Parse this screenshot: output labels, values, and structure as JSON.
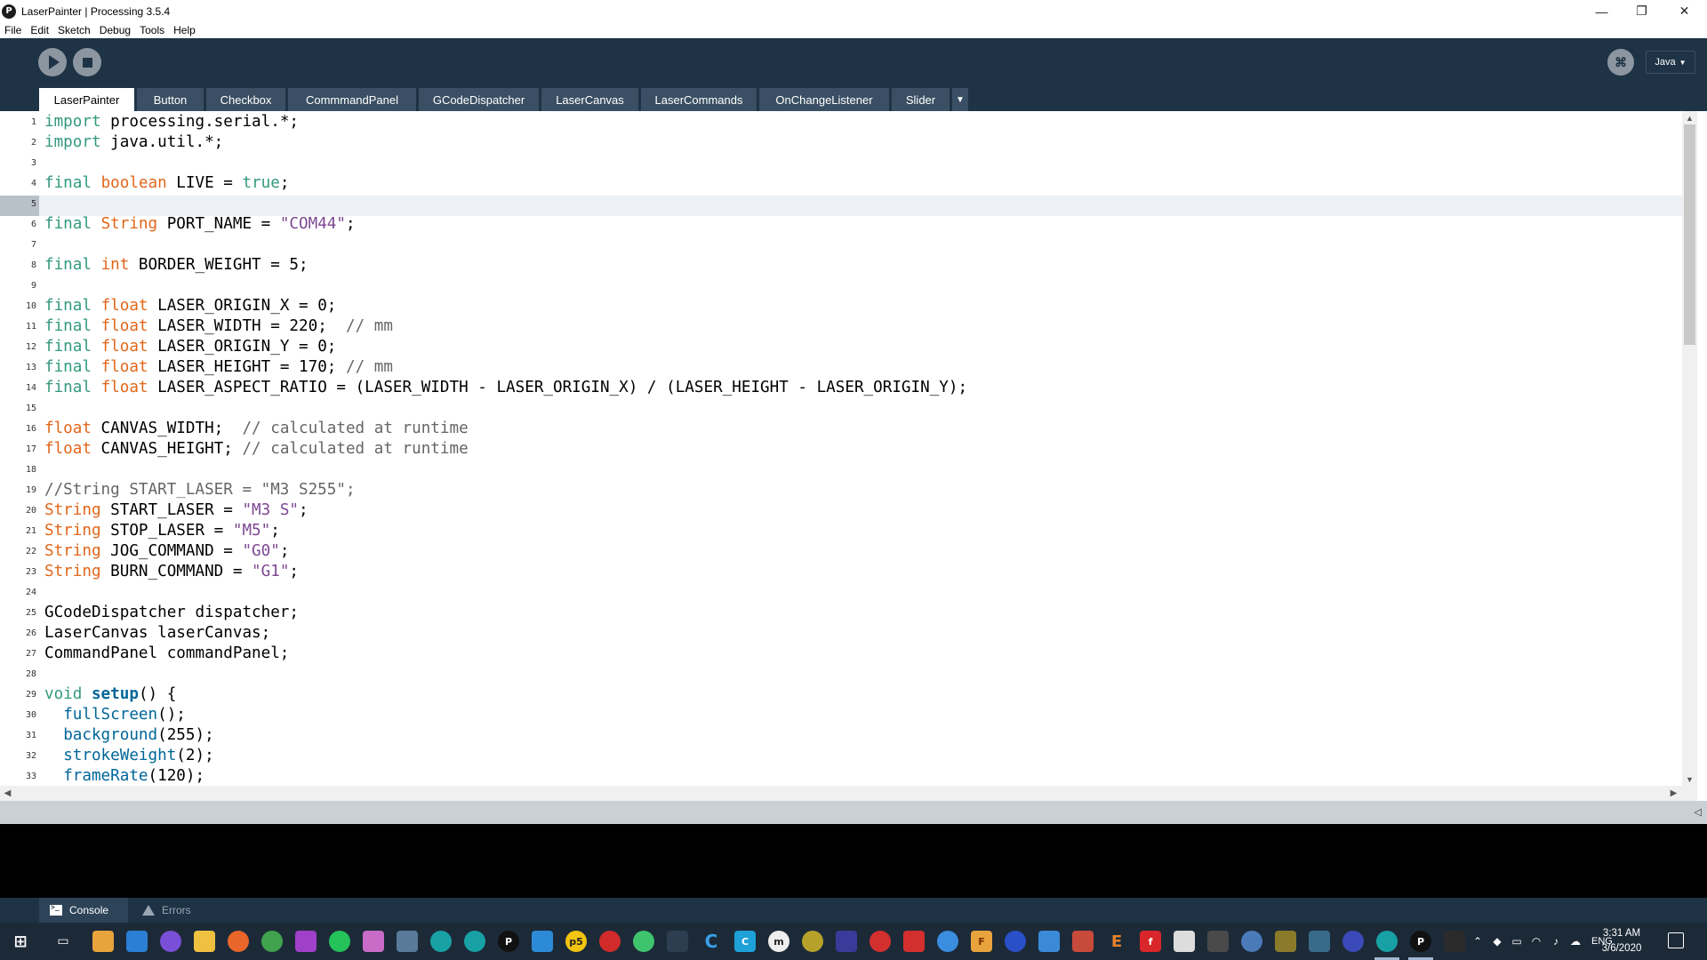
{
  "window": {
    "title": "LaserPainter | Processing 3.5.4",
    "app_icon_letter": "P",
    "controls": {
      "minimize": "—",
      "restore": "❐",
      "close": "✕"
    }
  },
  "menu": [
    "File",
    "Edit",
    "Sketch",
    "Debug",
    "Tools",
    "Help"
  ],
  "toolbar": {
    "run_label": "Run",
    "stop_label": "Stop",
    "mode_label": "Java",
    "mode_arrow": "▼"
  },
  "tabs": [
    {
      "label": "LaserPainter",
      "active": true
    },
    {
      "label": "Button"
    },
    {
      "label": "Checkbox"
    },
    {
      "label": "CommmandPanel"
    },
    {
      "label": "GCodeDispatcher"
    },
    {
      "label": "LaserCanvas"
    },
    {
      "label": "LaserCommands"
    },
    {
      "label": "OnChangeListener"
    },
    {
      "label": "Slider"
    }
  ],
  "tab_more_arrow": "▼",
  "editor": {
    "highlighted_line": 5,
    "lines": [
      {
        "n": "1",
        "tokens": [
          [
            "kw1",
            "import"
          ],
          [
            "",
            "processing.serial.*;"
          ]
        ]
      },
      {
        "n": "2",
        "tokens": [
          [
            "kw1",
            "import"
          ],
          [
            "",
            "java.util.*;"
          ]
        ]
      },
      {
        "n": "3",
        "tokens": []
      },
      {
        "n": "4",
        "tokens": [
          [
            "kw1",
            "final"
          ],
          [
            "",
            ""
          ],
          [
            "kw2",
            "boolean"
          ],
          [
            "",
            " LIVE = "
          ],
          [
            "kw1",
            "true"
          ],
          [
            "",
            ";"
          ]
        ]
      },
      {
        "n": "5",
        "tokens": []
      },
      {
        "n": "6",
        "tokens": [
          [
            "kw1",
            "final"
          ],
          [
            "",
            ""
          ],
          [
            "kw2",
            "String"
          ],
          [
            "",
            " PORT_NAME = "
          ],
          [
            "str",
            "\"COM44\""
          ],
          [
            "",
            ";"
          ]
        ]
      },
      {
        "n": "7",
        "tokens": []
      },
      {
        "n": "8",
        "tokens": [
          [
            "kw1",
            "final"
          ],
          [
            "",
            ""
          ],
          [
            "kw2",
            "int"
          ],
          [
            "",
            " BORDER_WEIGHT = 5;"
          ]
        ]
      },
      {
        "n": "9",
        "tokens": []
      },
      {
        "n": "10",
        "tokens": [
          [
            "kw1",
            "final"
          ],
          [
            "",
            ""
          ],
          [
            "kw2",
            "float"
          ],
          [
            "",
            " LASER_ORIGIN_X = 0;"
          ]
        ]
      },
      {
        "n": "11",
        "tokens": [
          [
            "kw1",
            "final"
          ],
          [
            "",
            ""
          ],
          [
            "kw2",
            "float"
          ],
          [
            "",
            " LASER_WIDTH = 220;  "
          ],
          [
            "cmt",
            "// mm"
          ]
        ]
      },
      {
        "n": "12",
        "tokens": [
          [
            "kw1",
            "final"
          ],
          [
            "",
            ""
          ],
          [
            "kw2",
            "float"
          ],
          [
            "",
            " LASER_ORIGIN_Y = 0;"
          ]
        ]
      },
      {
        "n": "13",
        "tokens": [
          [
            "kw1",
            "final"
          ],
          [
            "",
            ""
          ],
          [
            "kw2",
            "float"
          ],
          [
            "",
            " LASER_HEIGHT = 170; "
          ],
          [
            "cmt",
            "// mm"
          ]
        ]
      },
      {
        "n": "14",
        "tokens": [
          [
            "kw1",
            "final"
          ],
          [
            "",
            ""
          ],
          [
            "kw2",
            "float"
          ],
          [
            "",
            " LASER_ASPECT_RATIO = (LASER_WIDTH - LASER_ORIGIN_X) / (LASER_HEIGHT - LASER_ORIGIN_Y);"
          ]
        ]
      },
      {
        "n": "15",
        "tokens": []
      },
      {
        "n": "16",
        "tokens": [
          [
            "kw2",
            "float"
          ],
          [
            "",
            " CANVAS_WIDTH;  "
          ],
          [
            "cmt",
            "// calculated at runtime"
          ]
        ]
      },
      {
        "n": "17",
        "tokens": [
          [
            "kw2",
            "float"
          ],
          [
            "",
            " CANVAS_HEIGHT; "
          ],
          [
            "cmt",
            "// calculated at runtime"
          ]
        ]
      },
      {
        "n": "18",
        "tokens": []
      },
      {
        "n": "19",
        "tokens": [
          [
            "cmt",
            "//String START_LASER = \"M3 S255\";"
          ]
        ]
      },
      {
        "n": "20",
        "tokens": [
          [
            "kw2",
            "String"
          ],
          [
            "",
            " START_LASER = "
          ],
          [
            "str",
            "\"M3 S\""
          ],
          [
            "",
            ";"
          ]
        ]
      },
      {
        "n": "21",
        "tokens": [
          [
            "kw2",
            "String"
          ],
          [
            "",
            " STOP_LASER = "
          ],
          [
            "str",
            "\"M5\""
          ],
          [
            "",
            ";"
          ]
        ]
      },
      {
        "n": "22",
        "tokens": [
          [
            "kw2",
            "String"
          ],
          [
            "",
            " JOG_COMMAND = "
          ],
          [
            "str",
            "\"G0\""
          ],
          [
            "",
            ";"
          ]
        ]
      },
      {
        "n": "23",
        "tokens": [
          [
            "kw2",
            "String"
          ],
          [
            "",
            " BURN_COMMAND = "
          ],
          [
            "str",
            "\"G1\""
          ],
          [
            "",
            ";"
          ]
        ]
      },
      {
        "n": "24",
        "tokens": []
      },
      {
        "n": "25",
        "tokens": [
          [
            "",
            "GCodeDispatcher dispatcher;"
          ]
        ]
      },
      {
        "n": "26",
        "tokens": [
          [
            "",
            "LaserCanvas laserCanvas;"
          ]
        ]
      },
      {
        "n": "27",
        "tokens": [
          [
            "",
            "CommandPanel commandPanel;"
          ]
        ]
      },
      {
        "n": "28",
        "tokens": []
      },
      {
        "n": "29",
        "tokens": [
          [
            "kw1",
            "void"
          ],
          [
            "",
            " "
          ],
          [
            "fn",
            "setup"
          ],
          [
            "",
            "() {"
          ]
        ]
      },
      {
        "n": "30",
        "tokens": [
          [
            "",
            "  "
          ],
          [
            "kw3",
            "fullScreen"
          ],
          [
            "",
            "();"
          ]
        ]
      },
      {
        "n": "31",
        "tokens": [
          [
            "",
            "  "
          ],
          [
            "kw3",
            "background"
          ],
          [
            "",
            "(255);"
          ]
        ]
      },
      {
        "n": "32",
        "tokens": [
          [
            "",
            "  "
          ],
          [
            "kw3",
            "strokeWeight"
          ],
          [
            "",
            "(2);"
          ]
        ]
      },
      {
        "n": "33",
        "tokens": [
          [
            "",
            "  "
          ],
          [
            "kw3",
            "frameRate"
          ],
          [
            "",
            "(120);"
          ]
        ]
      }
    ]
  },
  "scroll_arrows": {
    "up": "▲",
    "down": "▼",
    "left": "◀",
    "right": "▶"
  },
  "status_collapse": "◁",
  "footer_tabs": [
    {
      "label": "Console",
      "active": true
    },
    {
      "label": "Errors"
    }
  ],
  "taskbar": {
    "tray_language": "ENG",
    "time": "3:31 AM",
    "date": "3/6/2020"
  }
}
